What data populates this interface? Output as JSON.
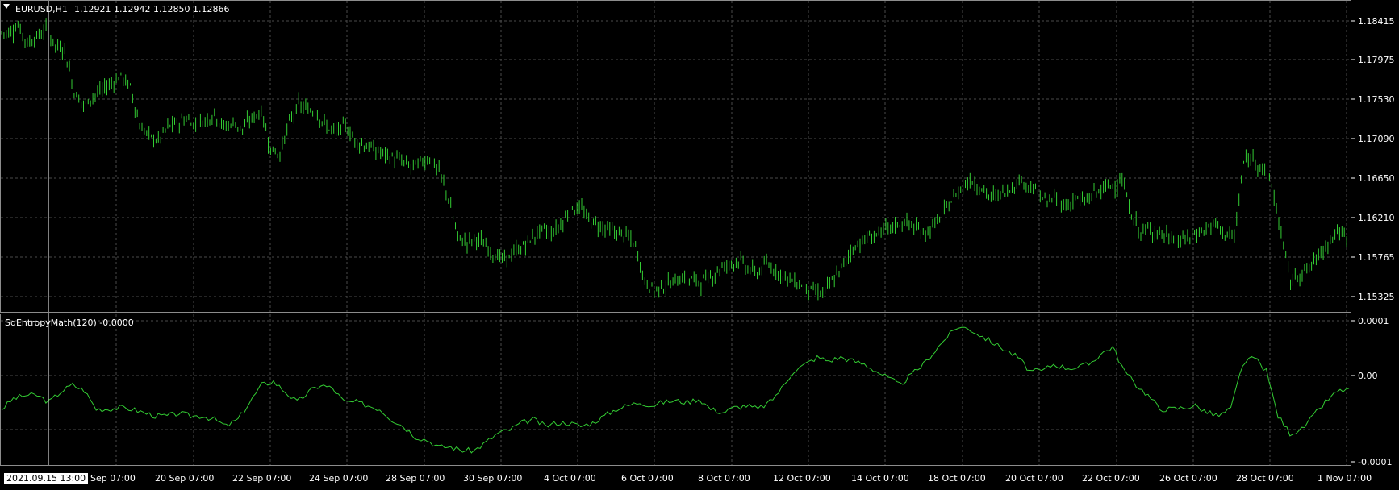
{
  "main_chart": {
    "symbol": "EURUSD,H1",
    "ohlc": "1.12921 1.12942 1.12850 1.12866",
    "price_labels": [
      "1.18415",
      "1.17975",
      "1.17530",
      "1.17090",
      "1.16650",
      "1.16210",
      "1.15765",
      "1.15325"
    ]
  },
  "indicator": {
    "title": "SqEntropyMath(120) -0.0000",
    "labels": [
      "0.0001",
      "0.00",
      "-0.0001"
    ]
  },
  "time_axis": {
    "labels": [
      "Sep 07:00",
      "20 Sep 07:00",
      "22 Sep 07:00",
      "24 Sep 07:00",
      "28 Sep 07:00",
      "30 Sep 07:00",
      "4 Oct 07:00",
      "6 Oct 07:00",
      "8 Oct 07:00",
      "12 Oct 07:00",
      "14 Oct 07:00",
      "18 Oct 07:00",
      "20 Oct 07:00",
      "22 Oct 07:00",
      "26 Oct 07:00",
      "28 Oct 07:00",
      "1 Nov 07:00"
    ],
    "crosshair_time": "2021.09.15 13:00"
  },
  "colors": {
    "background": "#000000",
    "candle": "#33cc33",
    "grid": "#4a4a4a",
    "text": "#ffffff",
    "indicator_line": "#33cc33"
  },
  "chart_data": [
    {
      "type": "candlestick",
      "ylim": [
        1.1512,
        1.1862
      ],
      "x_count": 100,
      "close": [
        1.1827,
        1.1835,
        1.1815,
        1.1822,
        1.183,
        1.1812,
        1.1808,
        1.176,
        1.1745,
        1.1755,
        1.1762,
        1.177,
        1.1778,
        1.1765,
        1.1722,
        1.171,
        1.1705,
        1.172,
        1.1725,
        1.173,
        1.1722,
        1.1728,
        1.1735,
        1.172,
        1.1725,
        1.1718,
        1.173,
        1.1738,
        1.1695,
        1.169,
        1.1725,
        1.1745,
        1.174,
        1.1735,
        1.172,
        1.1715,
        1.1722,
        1.1705,
        1.17,
        1.1695,
        1.169,
        1.1685,
        1.1682,
        1.1675,
        1.168,
        1.1685,
        1.167,
        1.164,
        1.1595,
        1.159,
        1.1595,
        1.1585,
        1.1575,
        1.157,
        1.1578,
        1.1585,
        1.1595,
        1.1605,
        1.16,
        1.161,
        1.1625,
        1.163,
        1.1615,
        1.161,
        1.1605,
        1.16,
        1.1598,
        1.1585,
        1.1545,
        1.1535,
        1.154,
        1.1545,
        1.155,
        1.1548,
        1.1545,
        1.155,
        1.156,
        1.1565,
        1.157,
        1.156,
        1.1555,
        1.1565,
        1.1558,
        1.155,
        1.1545,
        1.154,
        1.1535,
        1.1532,
        1.1545,
        1.156,
        1.158,
        1.159,
        1.1595,
        1.16,
        1.1605,
        1.161,
        1.1612,
        1.1605,
        1.16,
        1.161,
        1.1625,
        1.164,
        1.1655,
        1.166,
        1.165,
        1.164,
        1.1645,
        1.165,
        1.166,
        1.1655,
        1.1645,
        1.1635,
        1.164,
        1.163,
        1.164,
        1.1635,
        1.1645,
        1.165,
        1.1655,
        1.166,
        1.162,
        1.16,
        1.1605,
        1.16,
        1.1595,
        1.159,
        1.1595,
        1.16,
        1.1605,
        1.161,
        1.16,
        1.1595,
        1.168,
        1.1685,
        1.1675,
        1.1655,
        1.16,
        1.1545,
        1.1555,
        1.156,
        1.1575,
        1.159,
        1.1602,
        1.1595
      ]
    },
    {
      "type": "line",
      "name": "SqEntropyMath(120)",
      "ylim": [
        -0.00011,
        0.000105
      ],
      "values": [
        -3e-05,
        -1.5e-05,
        -1e-05,
        -1e-05,
        -2e-05,
        -5e-06,
        5e-06,
        -3e-06,
        -3e-05,
        -3e-05,
        -2.8e-05,
        -3e-05,
        -3.5e-05,
        -4e-05,
        -4e-05,
        -3.6e-05,
        -4e-05,
        -4e-05,
        -4.5e-05,
        -5.5e-05,
        -4.5e-05,
        -2e-05,
        5e-06,
        1e-05,
        -5e-06,
        -2e-05,
        -5e-06,
        5e-06,
        0.0,
        -2e-05,
        -2e-05,
        -2.5e-05,
        -3e-05,
        -4.5e-05,
        -5.5e-05,
        -7e-05,
        -7.5e-05,
        -8.5e-05,
        -8.5e-05,
        -9e-05,
        -9e-05,
        -7.8e-05,
        -6.5e-05,
        -6e-05,
        -5e-05,
        -4.5e-05,
        -5.5e-05,
        -5e-05,
        -5e-05,
        -5.5e-05,
        -5e-05,
        -4e-05,
        -3e-05,
        -2.5e-05,
        -2e-05,
        -2.5e-05,
        -2e-05,
        -1.8e-05,
        -2e-05,
        -1.5e-05,
        -3e-05,
        -3.5e-05,
        -2.8e-05,
        -2.5e-05,
        -3e-05,
        -2e-05,
        0.0,
        2.5e-05,
        3.5e-05,
        4.5e-05,
        4e-05,
        4.5e-05,
        4e-05,
        3.5e-05,
        2.5e-05,
        1.5e-05,
        5e-06,
        2e-05,
        3.5e-05,
        5.5e-05,
        7.5e-05,
        9e-05,
        8.5e-05,
        7.5e-05,
        6.5e-05,
        5.5e-05,
        4.5e-05,
        2.5e-05,
        2.5e-05,
        3.5e-05,
        3e-05,
        3e-05,
        3.5e-05,
        5e-05,
        6e-05,
        2.5e-05,
        5e-06,
        -1e-05,
        -3e-05,
        -3e-05,
        -2.8e-05,
        -2.5e-05,
        -3.5e-05,
        -4e-05,
        -3e-05,
        3.5e-05,
        4.5e-05,
        2.5e-05,
        -4e-05,
        -6.5e-05,
        -6e-05,
        -4e-05,
        -2e-05,
        -5e-06,
        0.0
      ]
    }
  ]
}
